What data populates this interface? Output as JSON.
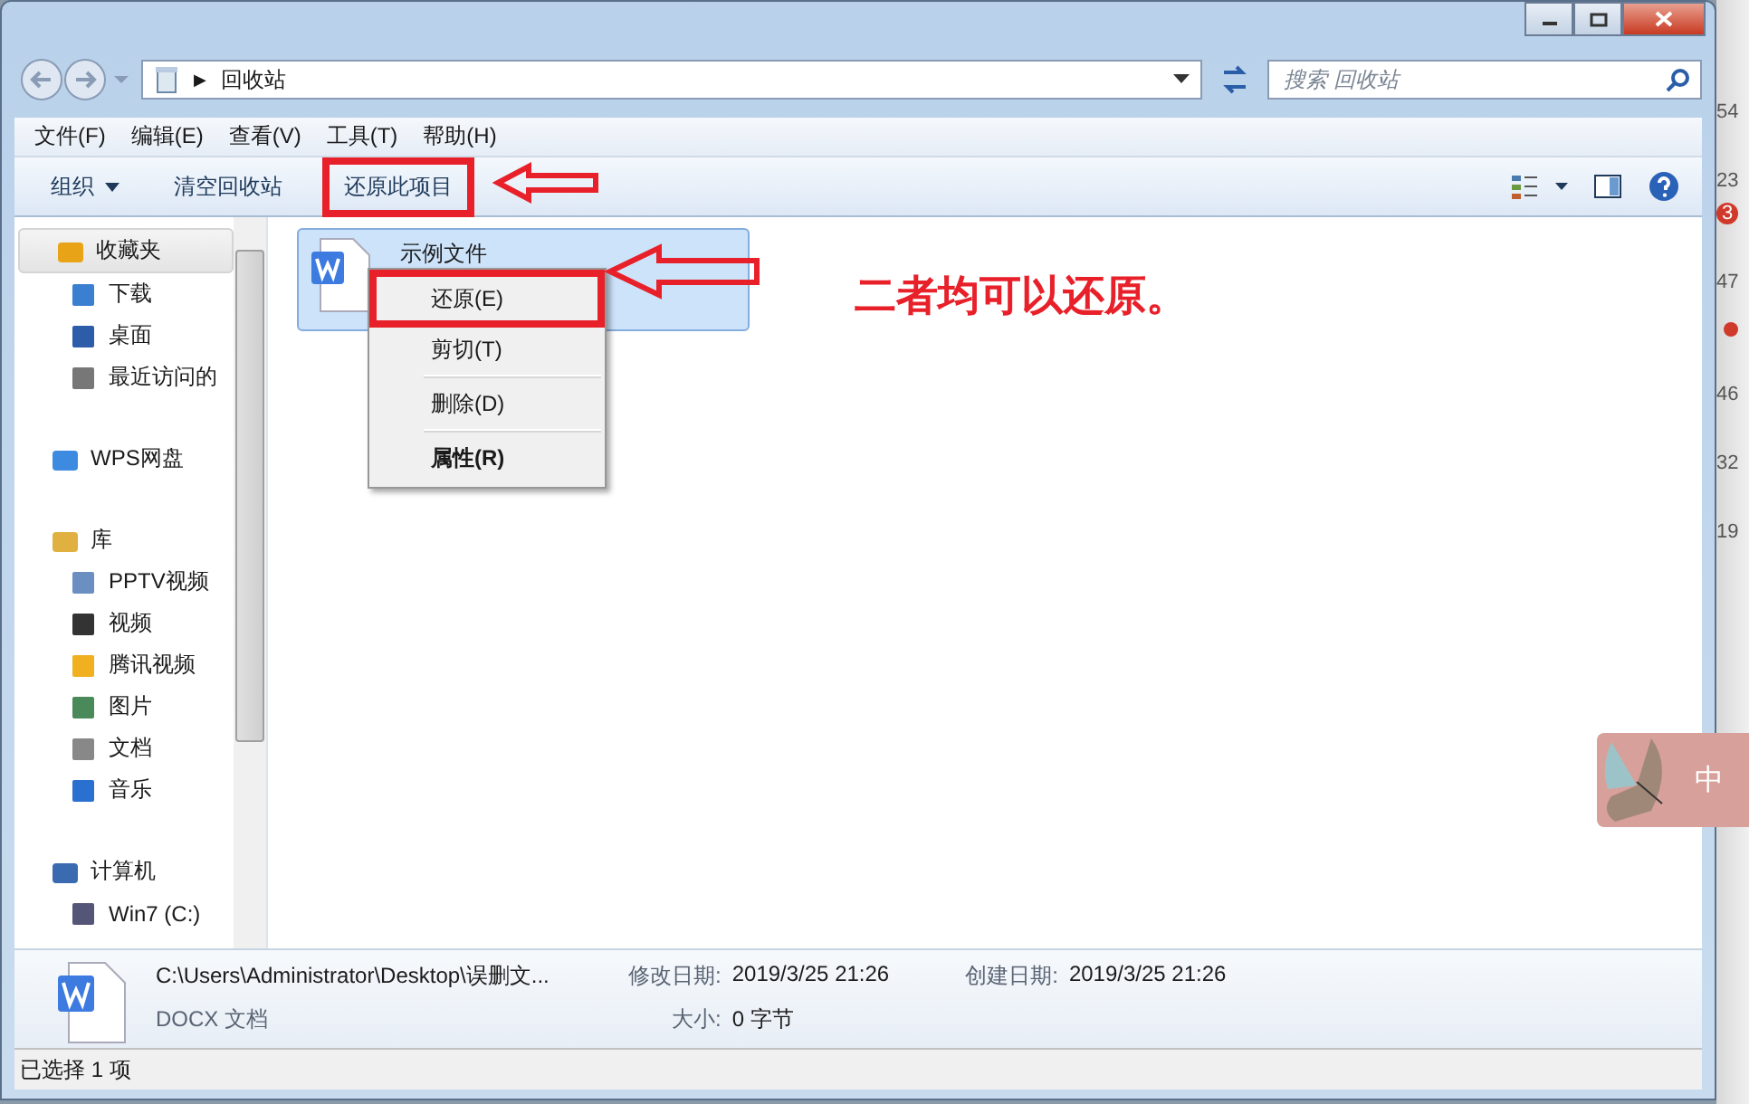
{
  "address_bar": {
    "separator": "▶",
    "path": "回收站"
  },
  "search": {
    "placeholder": "搜索 回收站"
  },
  "menu_bar": [
    "文件(F)",
    "编辑(E)",
    "查看(V)",
    "工具(T)",
    "帮助(H)"
  ],
  "toolbar": [
    {
      "label": "组织",
      "kind": "dropdown",
      "marked": false
    },
    {
      "label": "清空回收站",
      "kind": "plain",
      "marked": false
    },
    {
      "label": "还原此项目",
      "kind": "plain",
      "marked": true
    }
  ],
  "sidebar": [
    {
      "label": "收藏夹",
      "selected": true,
      "children": [
        {
          "label": "下载",
          "selected": false
        },
        {
          "label": "桌面",
          "selected": false
        },
        {
          "label": "最近访问的",
          "selected": false
        }
      ]
    },
    {
      "label": "WPS网盘",
      "selected": false
    },
    {
      "label": "库",
      "selected": false,
      "children": [
        {
          "label": "PPTV视频",
          "selected": false
        },
        {
          "label": "视频",
          "selected": false
        },
        {
          "label": "腾讯视频",
          "selected": false
        },
        {
          "label": "图片",
          "selected": false
        },
        {
          "label": "文档",
          "selected": false
        },
        {
          "label": "音乐",
          "selected": false
        }
      ]
    },
    {
      "label": "计算机",
      "selected": false,
      "children": [
        {
          "label": "Win7 (C:)",
          "selected": false
        }
      ]
    }
  ],
  "files": [
    {
      "name": "示例文件",
      "selected": true
    }
  ],
  "context_menu": [
    {
      "label": "还原(E)",
      "bold": false,
      "separator_before": false,
      "marked": true
    },
    {
      "label": "剪切(T)",
      "bold": false,
      "separator_before": false,
      "marked": false
    },
    {
      "label": "删除(D)",
      "bold": false,
      "separator_before": true,
      "marked": false
    },
    {
      "label": "属性(R)",
      "bold": true,
      "separator_before": true,
      "marked": false
    }
  ],
  "annotation": "二者均可以还原。",
  "details": {
    "path": "C:\\Users\\Administrator\\Desktop\\误删文...",
    "type": "DOCX 文档",
    "modified_label": "修改日期:",
    "modified": "2019/3/25 21:26",
    "created_label": "创建日期:",
    "created": "2019/3/25 21:26",
    "size_label": "大小:",
    "size": "0 字节"
  },
  "status_bar": "已选择 1 项",
  "desktop_strip": {
    "numbers": [
      "54",
      "23",
      "47",
      "46",
      "32",
      "19"
    ],
    "badge": "3"
  },
  "ime": {
    "label": "中"
  }
}
